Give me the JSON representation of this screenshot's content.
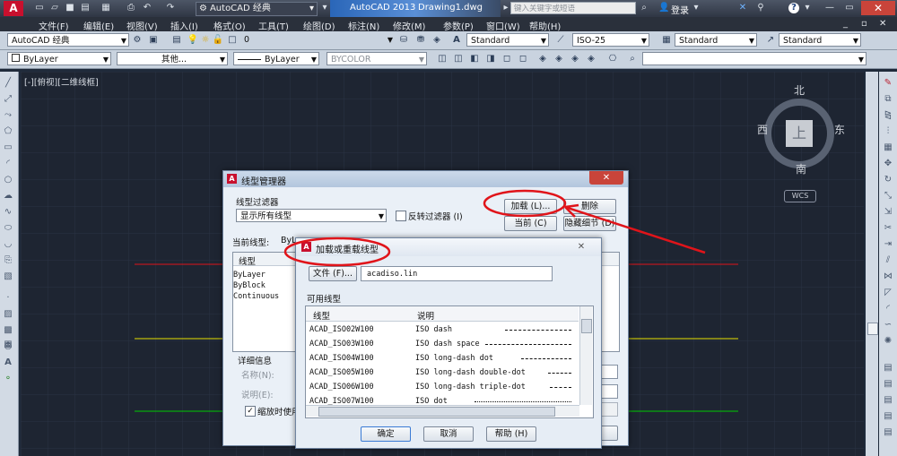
{
  "titlebar": {
    "workspace": "AutoCAD 经典",
    "app_title": "AutoCAD 2013",
    "doc_title": "Drawing1.dwg",
    "search_placeholder": "键入关键字或短语",
    "login": "登录"
  },
  "menu": [
    "文件(F)",
    "编辑(E)",
    "视图(V)",
    "插入(I)",
    "格式(O)",
    "工具(T)",
    "绘图(D)",
    "标注(N)",
    "修改(M)",
    "参数(P)",
    "窗口(W)",
    "帮助(H)"
  ],
  "toolbar2": {
    "workspace": "AutoCAD 经典",
    "layer": "0",
    "text_style": "Standard",
    "dim_style": "ISO-25",
    "table_style": "Standard",
    "mleader_style": "Standard"
  },
  "toolbar3": {
    "color": "ByLayer",
    "linetype": "其他...",
    "lineweight": "ByLayer",
    "plot_style": "BYCOLOR"
  },
  "viewport_label": "[-][俯视][二维线框]",
  "viewcube": {
    "north": "北",
    "south": "南",
    "west": "西",
    "east": "东",
    "top": "上",
    "wcs": "WCS"
  },
  "ltmanager": {
    "title": "线型管理器",
    "filter_label": "线型过滤器",
    "filter_value": "显示所有线型",
    "invert_filter": "反转过滤器 (I)",
    "load_button": "加载 (L)...",
    "delete_button": "删除",
    "current_button": "当前 (C)",
    "hide_details_button": "隐藏细节 (D)",
    "current_linetype_label": "当前线型:",
    "current_linetype_value": "ByLayer",
    "list_header": "线型",
    "list_items": [
      "ByLayer",
      "ByBlock",
      "Continuous"
    ],
    "details_label": "详细信息",
    "name_label": "名称(N):",
    "desc_label": "说明(E):",
    "scale_checkbox": "缩放时使用"
  },
  "loaddlg": {
    "title": "加载或重载线型",
    "file_button": "文件 (F)...",
    "file_value": "acadiso.lin",
    "available_label": "可用线型",
    "col_linetype": "线型",
    "col_desc": "说明",
    "rows": [
      {
        "name": "ACAD_ISO02W100",
        "desc": "ISO dash"
      },
      {
        "name": "ACAD_ISO03W100",
        "desc": "ISO dash space"
      },
      {
        "name": "ACAD_ISO04W100",
        "desc": "ISO long-dash dot"
      },
      {
        "name": "ACAD_ISO05W100",
        "desc": "ISO long-dash double-dot"
      },
      {
        "name": "ACAD_ISO06W100",
        "desc": "ISO long-dash triple-dot"
      },
      {
        "name": "ACAD_ISO07W100",
        "desc": "ISO dot"
      }
    ],
    "ok": "确定",
    "cancel": "取消",
    "help": "帮助 (H)"
  },
  "colors": {
    "annotation_red": "#e0141a",
    "canvas": "#1e2532"
  }
}
